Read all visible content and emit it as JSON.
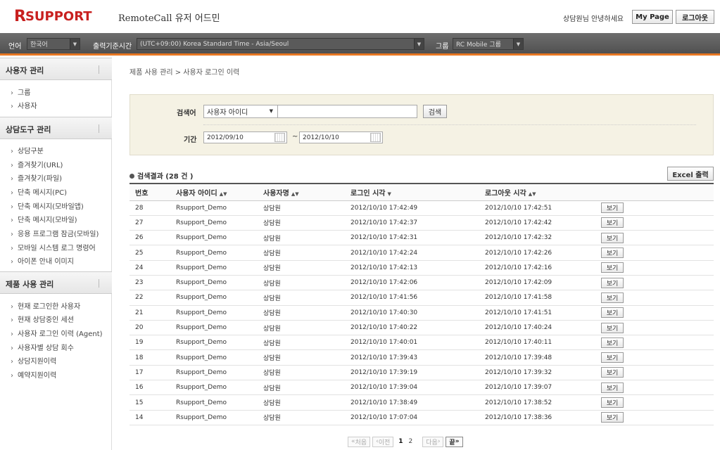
{
  "header": {
    "logo_r": "R",
    "logo_rest": "SUPPORT",
    "app_title": "RemoteCall 유저 어드민",
    "greeting": "상담원님 안녕하세요",
    "mypage_label": "My Page",
    "logout_label": "로그아웃"
  },
  "toolbar": {
    "language_label": "언어",
    "language_value": "한국어",
    "timezone_label": "출력기준시간",
    "timezone_value": "(UTC+09:00) Korea Standard Time - Asia/Seoul",
    "group_label": "그룹",
    "group_value": "RC Mobile 그룹",
    "accent_color": "#e87722"
  },
  "sidebar": {
    "sections": [
      {
        "title": "사용자 관리",
        "items": [
          "그룹",
          "사용자"
        ]
      },
      {
        "title": "상담도구 관리",
        "items": [
          "상담구분",
          "즐겨찾기(URL)",
          "즐겨찾기(파일)",
          "단축 메시지(PC)",
          "단축 메시지(모바일앱)",
          "단축 메시지(모바일)",
          "응용 프로그램 잠금(모바일)",
          "모바일 시스템 로그 명령어",
          "아이폰 안내 이미지"
        ]
      },
      {
        "title": "제품 사용 관리",
        "items": [
          "현재 로그인한 사용자",
          "현재 상담중인 세션",
          "사용자 로그인 이력 (Agent)",
          "사용자별 상담 회수",
          "상담지원이력",
          "예약지원이력"
        ]
      }
    ]
  },
  "breadcrumb": "제품 사용 관리 > 사용자 로그인 이력",
  "search": {
    "keyword_label": "검색어",
    "keyword_type": "사용자 아이디",
    "keyword_value": "",
    "search_button": "검색",
    "period_label": "기간",
    "date_from": "2012/09/10",
    "date_sep": "~",
    "date_to": "2012/10/10"
  },
  "results": {
    "title": "검색결과 (28 건 )",
    "excel_button": "Excel 출력",
    "columns": [
      "번호",
      "사용자 아이디",
      "사용자명",
      "로그인 시각",
      "로그아웃 시각",
      ""
    ],
    "view_label": "보기",
    "rows": [
      [
        "28",
        "Rsupport_Demo",
        "상담원",
        "2012/10/10 17:42:49",
        "2012/10/10 17:42:51"
      ],
      [
        "27",
        "Rsupport_Demo",
        "상담원",
        "2012/10/10 17:42:37",
        "2012/10/10 17:42:42"
      ],
      [
        "26",
        "Rsupport_Demo",
        "상담원",
        "2012/10/10 17:42:31",
        "2012/10/10 17:42:32"
      ],
      [
        "25",
        "Rsupport_Demo",
        "상담원",
        "2012/10/10 17:42:24",
        "2012/10/10 17:42:26"
      ],
      [
        "24",
        "Rsupport_Demo",
        "상담원",
        "2012/10/10 17:42:13",
        "2012/10/10 17:42:16"
      ],
      [
        "23",
        "Rsupport_Demo",
        "상담원",
        "2012/10/10 17:42:06",
        "2012/10/10 17:42:09"
      ],
      [
        "22",
        "Rsupport_Demo",
        "상담원",
        "2012/10/10 17:41:56",
        "2012/10/10 17:41:58"
      ],
      [
        "21",
        "Rsupport_Demo",
        "상담원",
        "2012/10/10 17:40:30",
        "2012/10/10 17:41:51"
      ],
      [
        "20",
        "Rsupport_Demo",
        "상담원",
        "2012/10/10 17:40:22",
        "2012/10/10 17:40:24"
      ],
      [
        "19",
        "Rsupport_Demo",
        "상담원",
        "2012/10/10 17:40:01",
        "2012/10/10 17:40:11"
      ],
      [
        "18",
        "Rsupport_Demo",
        "상담원",
        "2012/10/10 17:39:43",
        "2012/10/10 17:39:48"
      ],
      [
        "17",
        "Rsupport_Demo",
        "상담원",
        "2012/10/10 17:39:19",
        "2012/10/10 17:39:32"
      ],
      [
        "16",
        "Rsupport_Demo",
        "상담원",
        "2012/10/10 17:39:04",
        "2012/10/10 17:39:07"
      ],
      [
        "15",
        "Rsupport_Demo",
        "상담원",
        "2012/10/10 17:38:49",
        "2012/10/10 17:38:52"
      ],
      [
        "14",
        "Rsupport_Demo",
        "상담원",
        "2012/10/10 17:07:04",
        "2012/10/10 17:38:36"
      ]
    ]
  },
  "pagination": {
    "first": "처음",
    "prev": "이전",
    "pages": [
      "1",
      "2"
    ],
    "current": "1",
    "next": "다음",
    "last": "끝"
  }
}
